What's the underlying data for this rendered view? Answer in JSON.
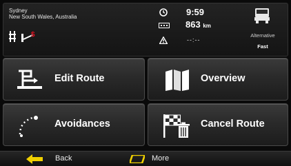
{
  "location": {
    "city": "Sydney",
    "region": "New South Wales, Australia"
  },
  "stats": {
    "time": "9:59",
    "distance_value": "863",
    "distance_unit": "km",
    "eta": "--:--"
  },
  "route_profile": {
    "type": "Alternative",
    "mode": "Fast",
    "vehicle_icon": "truck-icon"
  },
  "menu": {
    "edit_route": "Edit Route",
    "overview": "Overview",
    "avoidances": "Avoidances",
    "cancel_route": "Cancel Route"
  },
  "bottom_bar": {
    "back": "Back",
    "more": "More"
  },
  "colors": {
    "accent_yellow": "#f0d000",
    "status_red": "#e01020"
  }
}
